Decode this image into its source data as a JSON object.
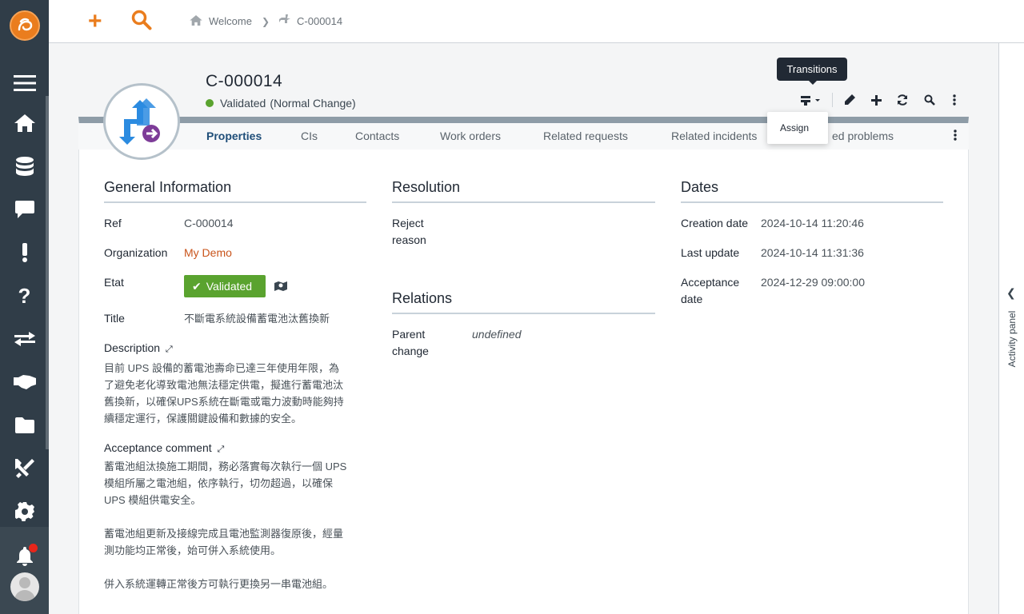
{
  "breadcrumb": {
    "home": "Welcome",
    "current": "C-000014"
  },
  "object": {
    "ref": "C-000014",
    "status": "Validated",
    "status_subtype": "(Normal Change)"
  },
  "toolbar": {
    "tooltip": "Transitions",
    "dropdown_item": "Assign"
  },
  "tabs": [
    "Properties",
    "CIs",
    "Contacts",
    "Work orders",
    "Related requests",
    "Related incidents",
    "ed problems"
  ],
  "general": {
    "title": "General Information",
    "ref_label": "Ref",
    "ref_value": "C-000014",
    "org_label": "Organization",
    "org_value": "My Demo",
    "etat_label": "Etat",
    "etat_value": "Validated",
    "title_label": "Title",
    "title_value": "不斷電系統設備蓄電池汰舊換新",
    "desc_label": "Description",
    "desc_lines": [
      "目前 UPS 設備的蓄電池壽命已達三年使用年限，為",
      "了避免老化導致電池無法穩定供電，擬進行蓄電池汰",
      "舊換新，以確保UPS系統在斷電或電力波動時能夠持",
      "續穩定運行，保護關鍵設備和數據的安全。"
    ],
    "accept_label": "Acceptance comment",
    "accept_lines": [
      "蓄電池組汰換施工期間，務必落實每次執行一個 UPS",
      "模組所屬之電池組，依序執行，切勿超過，以確保",
      "UPS 模組供電安全。",
      "",
      "蓄電池組更新及接線完成且電池監測器復原後，經量",
      "測功能均正常後，始可併入系統使用。",
      "",
      "併入系統運轉正常後方可執行更換另一串電池組。"
    ]
  },
  "resolution": {
    "title": "Resolution",
    "reject_label_1": "Reject",
    "reject_label_2": "reason"
  },
  "relations": {
    "title": "Relations",
    "parent_label_1": "Parent",
    "parent_label_2": "change",
    "parent_value": "undefined"
  },
  "dates": {
    "title": "Dates",
    "creation_label": "Creation date",
    "creation_value": "2024-10-14 11:20:46",
    "update_label": "Last update",
    "update_value": "2024-10-14 11:31:36",
    "accept_label_1": "Acceptance",
    "accept_label_2": "date",
    "accept_value": "2024-12-29 09:00:00"
  },
  "activity_panel": "Activity panel",
  "colors": {
    "brand": "#ea7d1e",
    "status_ok": "#5aa32f",
    "nav_bg": "#303d48",
    "link": "#c9541b"
  }
}
